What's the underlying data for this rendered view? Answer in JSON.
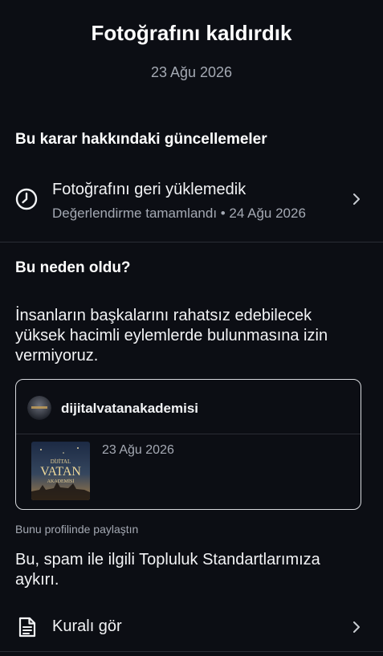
{
  "header": {
    "title": "Fotoğrafını kaldırdık",
    "date": "23 Ağu 2026"
  },
  "updates": {
    "heading": "Bu karar hakkındaki güncellemeler",
    "item": {
      "icon": "clock-icon",
      "title": "Fotoğrafını geri yüklemedik",
      "subtitle": "Değerlendirme tamamlandı • 24 Ağu 2026"
    }
  },
  "why": {
    "heading": "Bu neden oldu?",
    "text": "İnsanların başkalarını rahatsız edebilecek yüksek hacimli eylemlerde bulunmasına izin vermiyoruz."
  },
  "post_card": {
    "account_name": "dijitalvatanakademisi",
    "post_date": "23 Ağu 2026",
    "thumbnail_text": [
      "DİJİTAL",
      "VATAN",
      "AKADEMİSİ"
    ]
  },
  "shared_note": "Bunu profilinde paylaştın",
  "violation_text": "Bu, spam ile ilgili Topluluk Standartlarımıza aykırı.",
  "rule_link": {
    "icon": "document-icon",
    "label": "Kuralı gör"
  },
  "colors": {
    "background": "#0c0e14",
    "text_primary": "#f2f3f5",
    "text_secondary": "#a4a9b3",
    "divider": "#2a2d35",
    "card_border": "#d8dade"
  }
}
